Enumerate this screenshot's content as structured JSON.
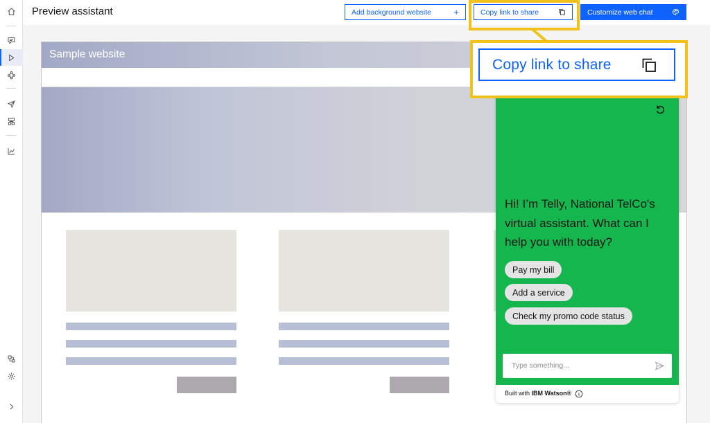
{
  "header": {
    "title": "Preview assistant",
    "add_background_label": "Add background website",
    "add_icon_glyph": "+",
    "copy_link_label": "Copy link to share",
    "customize_label": "Customize web chat"
  },
  "rail": {
    "icons": [
      "home-icon",
      "chat-icon",
      "preview-icon",
      "actions-icon",
      "publish-icon",
      "environments-icon",
      "analytics-icon",
      "integrations-icon",
      "settings-icon",
      "expand-icon"
    ]
  },
  "sample_site": {
    "title": "Sample website"
  },
  "chat": {
    "greeting": "Hi! I’m Telly, National TelCo's virtual assistant. What can I help you with today?",
    "options": [
      "Pay my bill",
      "Add a service",
      "Check my promo code status"
    ],
    "input_placeholder": "Type something...",
    "built_prefix": "Built with ",
    "built_brand": "IBM Watson®"
  },
  "callout": {
    "label": "Copy link to share"
  },
  "colors": {
    "primary": "#0f62fe",
    "highlight": "#f1c21b",
    "chat_background": "#16b64e"
  }
}
